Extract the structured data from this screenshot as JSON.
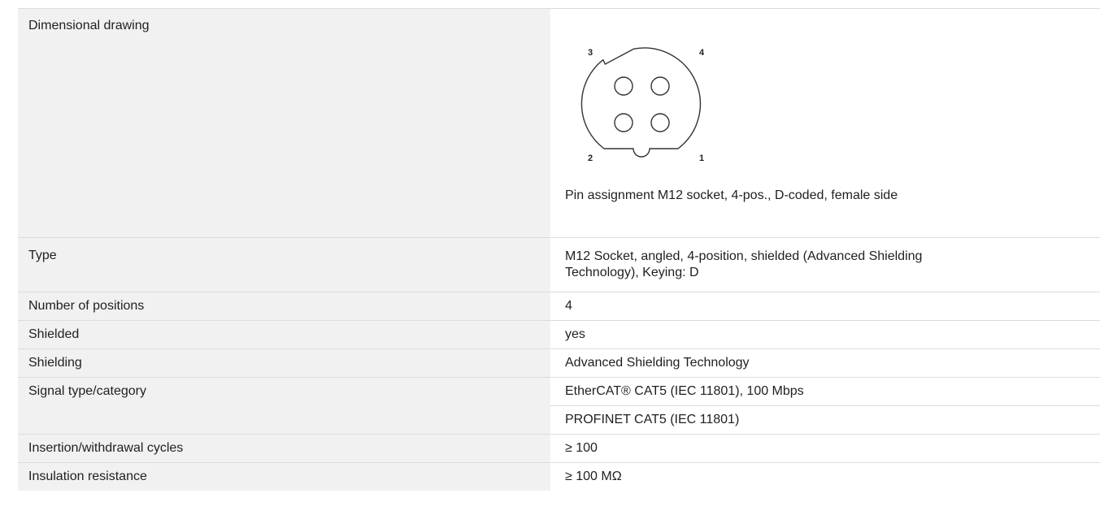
{
  "drawing": {
    "label": "Dimensional drawing",
    "pins": [
      "3",
      "4",
      "2",
      "1"
    ],
    "caption": "Pin assignment M12 socket, 4-pos., D-coded, female side"
  },
  "specs": {
    "type": {
      "label": "Type",
      "value_line1": "M12 Socket, angled, 4-position, shielded (Advanced Shielding",
      "value_line2": "Technology), Keying: D"
    },
    "positions": {
      "label": "Number of positions",
      "value": "4"
    },
    "shielded": {
      "label": "Shielded",
      "value": "yes"
    },
    "shielding": {
      "label": "Shielding",
      "value": "Advanced Shielding Technology"
    },
    "signal": {
      "label": "Signal type/category",
      "values": [
        "EtherCAT® CAT5 (IEC 11801), 100 Mbps",
        "PROFINET CAT5 (IEC 11801)"
      ]
    },
    "cycles": {
      "label": "Insertion/withdrawal cycles",
      "value": "≥ 100"
    },
    "insulation": {
      "label": "Insulation resistance",
      "value": "≥ 100 MΩ"
    }
  }
}
